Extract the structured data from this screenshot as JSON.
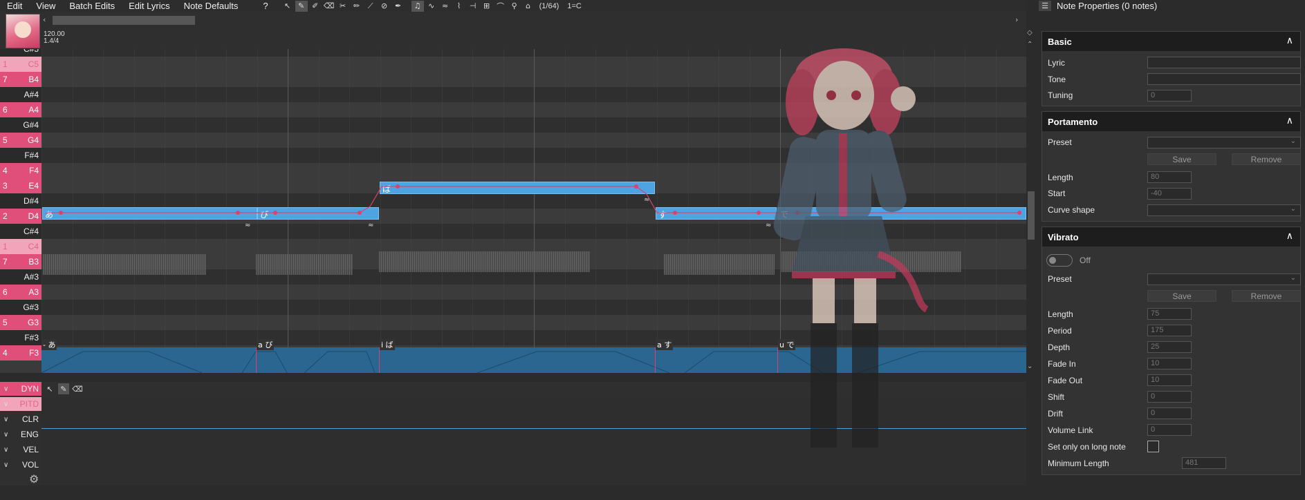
{
  "menu": {
    "items": [
      "Edit",
      "Batch Edits",
      "Edit Lyrics",
      "Note Defaults",
      "?"
    ],
    "snap": "(1/64)",
    "key": "1=C"
  },
  "tempo": {
    "bpm": "120.00",
    "meter": "1.4/4"
  },
  "keys": [
    {
      "label": "C#5",
      "num": "",
      "type": "black"
    },
    {
      "label": "C5",
      "num": "1",
      "type": "c"
    },
    {
      "label": "B4",
      "num": "7",
      "type": "white"
    },
    {
      "label": "A#4",
      "num": "",
      "type": "black"
    },
    {
      "label": "A4",
      "num": "6",
      "type": "white"
    },
    {
      "label": "G#4",
      "num": "",
      "type": "black"
    },
    {
      "label": "G4",
      "num": "5",
      "type": "white"
    },
    {
      "label": "F#4",
      "num": "",
      "type": "black"
    },
    {
      "label": "F4",
      "num": "4",
      "type": "white"
    },
    {
      "label": "E4",
      "num": "3",
      "type": "white"
    },
    {
      "label": "D#4",
      "num": "",
      "type": "black"
    },
    {
      "label": "D4",
      "num": "2",
      "type": "white"
    },
    {
      "label": "C#4",
      "num": "",
      "type": "black"
    },
    {
      "label": "C4",
      "num": "1",
      "type": "c"
    },
    {
      "label": "B3",
      "num": "7",
      "type": "white"
    },
    {
      "label": "A#3",
      "num": "",
      "type": "black"
    },
    {
      "label": "A3",
      "num": "6",
      "type": "white"
    },
    {
      "label": "G#3",
      "num": "",
      "type": "black"
    },
    {
      "label": "G3",
      "num": "5",
      "type": "white"
    },
    {
      "label": "F#3",
      "num": "",
      "type": "black"
    },
    {
      "label": "F3",
      "num": "4",
      "type": "white"
    }
  ],
  "notes": [
    {
      "lyric": "あ",
      "pitch": "C4"
    },
    {
      "lyric": "び",
      "pitch": "C4"
    },
    {
      "lyric": "ば",
      "pitch": "D4"
    },
    {
      "lyric": "す",
      "pitch": "C4"
    },
    {
      "lyric": "で",
      "pitch": "C4"
    }
  ],
  "phonemes": [
    "- あ",
    "a び",
    "i ば",
    "a す",
    "u で"
  ],
  "expressions": {
    "rows": [
      "DYN",
      "PITD",
      "CLR",
      "ENG",
      "VEL",
      "VOL"
    ]
  },
  "props": {
    "title": "Note Properties (0 notes)",
    "basic": {
      "title": "Basic",
      "lyric_label": "Lyric",
      "tone_label": "Tone",
      "tuning_label": "Tuning",
      "tuning_value": "0"
    },
    "portamento": {
      "title": "Portamento",
      "preset_label": "Preset",
      "save_label": "Save",
      "remove_label": "Remove",
      "length_label": "Length",
      "length_value": "80",
      "start_label": "Start",
      "start_value": "-40",
      "curve_label": "Curve shape"
    },
    "vibrato": {
      "title": "Vibrato",
      "toggle_label": "Off",
      "preset_label": "Preset",
      "save_label": "Save",
      "remove_label": "Remove",
      "length_label": "Length",
      "length_value": "75",
      "period_label": "Period",
      "period_value": "175",
      "depth_label": "Depth",
      "depth_value": "25",
      "fadein_label": "Fade In",
      "fadein_value": "10",
      "fadeout_label": "Fade Out",
      "fadeout_value": "10",
      "shift_label": "Shift",
      "shift_value": "0",
      "drift_label": "Drift",
      "drift_value": "0",
      "vollink_label": "Volume Link",
      "vollink_value": "0",
      "longnote_label": "Set only on long note",
      "minlen_label": "Minimum Length",
      "minlen_value": "481"
    }
  },
  "colors": {
    "accent": "#e04e7a",
    "note": "#4ea4e3",
    "pitch": "#e0406a"
  }
}
